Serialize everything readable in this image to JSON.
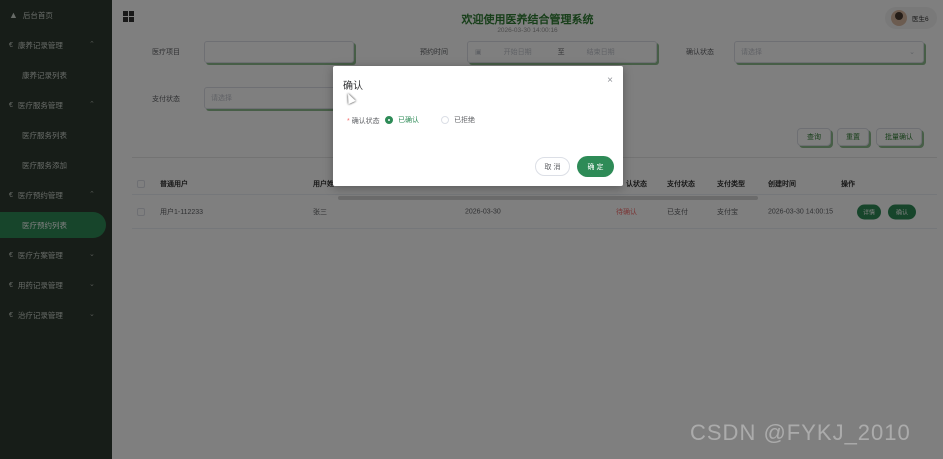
{
  "sidebar": {
    "home": "后台首页",
    "groups": [
      {
        "label": "康养记录管理",
        "expanded": true,
        "items": [
          "康养记录列表"
        ]
      },
      {
        "label": "医疗服务管理",
        "expanded": true,
        "items": [
          "医疗服务列表",
          "医疗服务添加"
        ]
      },
      {
        "label": "医疗预约管理",
        "expanded": true,
        "items": [
          "医疗预约列表"
        ]
      },
      {
        "label": "医疗方案管理",
        "expanded": false,
        "items": []
      },
      {
        "label": "用药记录管理",
        "expanded": false,
        "items": []
      },
      {
        "label": "治疗记录管理",
        "expanded": false,
        "items": []
      }
    ],
    "active_item": "医疗预约列表"
  },
  "header": {
    "title": "欢迎使用医养结合管理系统",
    "datetime": "2026-03-30 14:00:16",
    "user_name": "医生6"
  },
  "filters": {
    "item_label": "医疗项目",
    "item_value": "",
    "time_label": "预约时间",
    "date_start_placeholder": "开始日期",
    "date_sep": "至",
    "date_end_placeholder": "结束日期",
    "confirm_label": "确认状态",
    "confirm_placeholder": "请选择",
    "pay_label": "支付状态",
    "pay_placeholder": "请选择",
    "btn_search": "查询",
    "btn_reset": "重置",
    "btn_batch": "批量确认"
  },
  "table": {
    "headers": [
      "普通用户",
      "用户姓",
      "认状态",
      "支付状态",
      "支付类型",
      "创建时间",
      "操作"
    ],
    "rows": [
      {
        "user": "用户1-112233",
        "name": "张三",
        "date": "2026-03-30",
        "confirm_status": "待确认",
        "pay_status": "已支付",
        "pay_type": "支付宝",
        "created": "2026-03-30 14:00:15",
        "btn_detail": "详情",
        "btn_confirm": "确认"
      }
    ]
  },
  "dialog": {
    "title": "确认",
    "close": "×",
    "field_label": "确认状态",
    "required_mark": "*",
    "options": [
      "已确认",
      "已拒绝"
    ],
    "selected": "已确认",
    "btn_cancel": "取 消",
    "btn_ok": "确 定"
  },
  "watermark": "CSDN @FYKJ_2010",
  "colors": {
    "sidebar_bg": "#2f3a30",
    "primary": "#2e8b57",
    "title": "#2e7d32",
    "danger": "#f56c6c"
  },
  "icons": [
    "home-icon",
    "menu-grid-icon",
    "collapse-arrow-icon",
    "close-icon"
  ]
}
